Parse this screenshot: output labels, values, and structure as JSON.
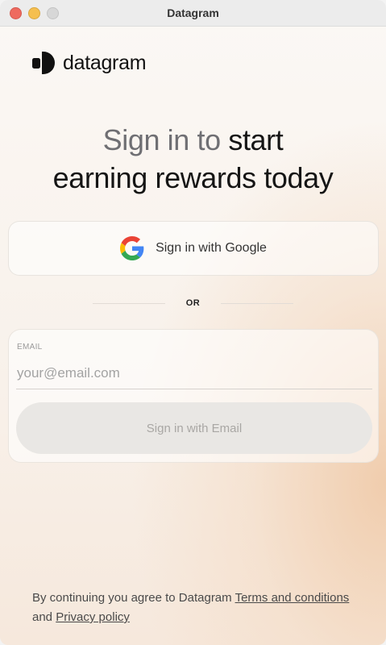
{
  "window": {
    "title": "Datagram"
  },
  "logo": {
    "text": "datagram",
    "icon": "datagram-logo-icon"
  },
  "headline": {
    "part1": "Sign in to",
    "part2": "start",
    "line2": "earning rewards today"
  },
  "google_button": {
    "label": "Sign in with Google",
    "icon": "google-icon"
  },
  "divider": {
    "text": "OR"
  },
  "email": {
    "label": "EMAIL",
    "placeholder": "your@email.com",
    "value": "",
    "button_label": "Sign in with Email"
  },
  "footer": {
    "prefix": "By continuing you agree to Datagram",
    "terms_label": "Terms and conditions",
    "and_text": "and",
    "privacy_label": "Privacy policy"
  },
  "colors": {
    "accent_gradient": "#f0cbaa",
    "text_primary": "#151515",
    "text_muted": "#6f6f73"
  }
}
